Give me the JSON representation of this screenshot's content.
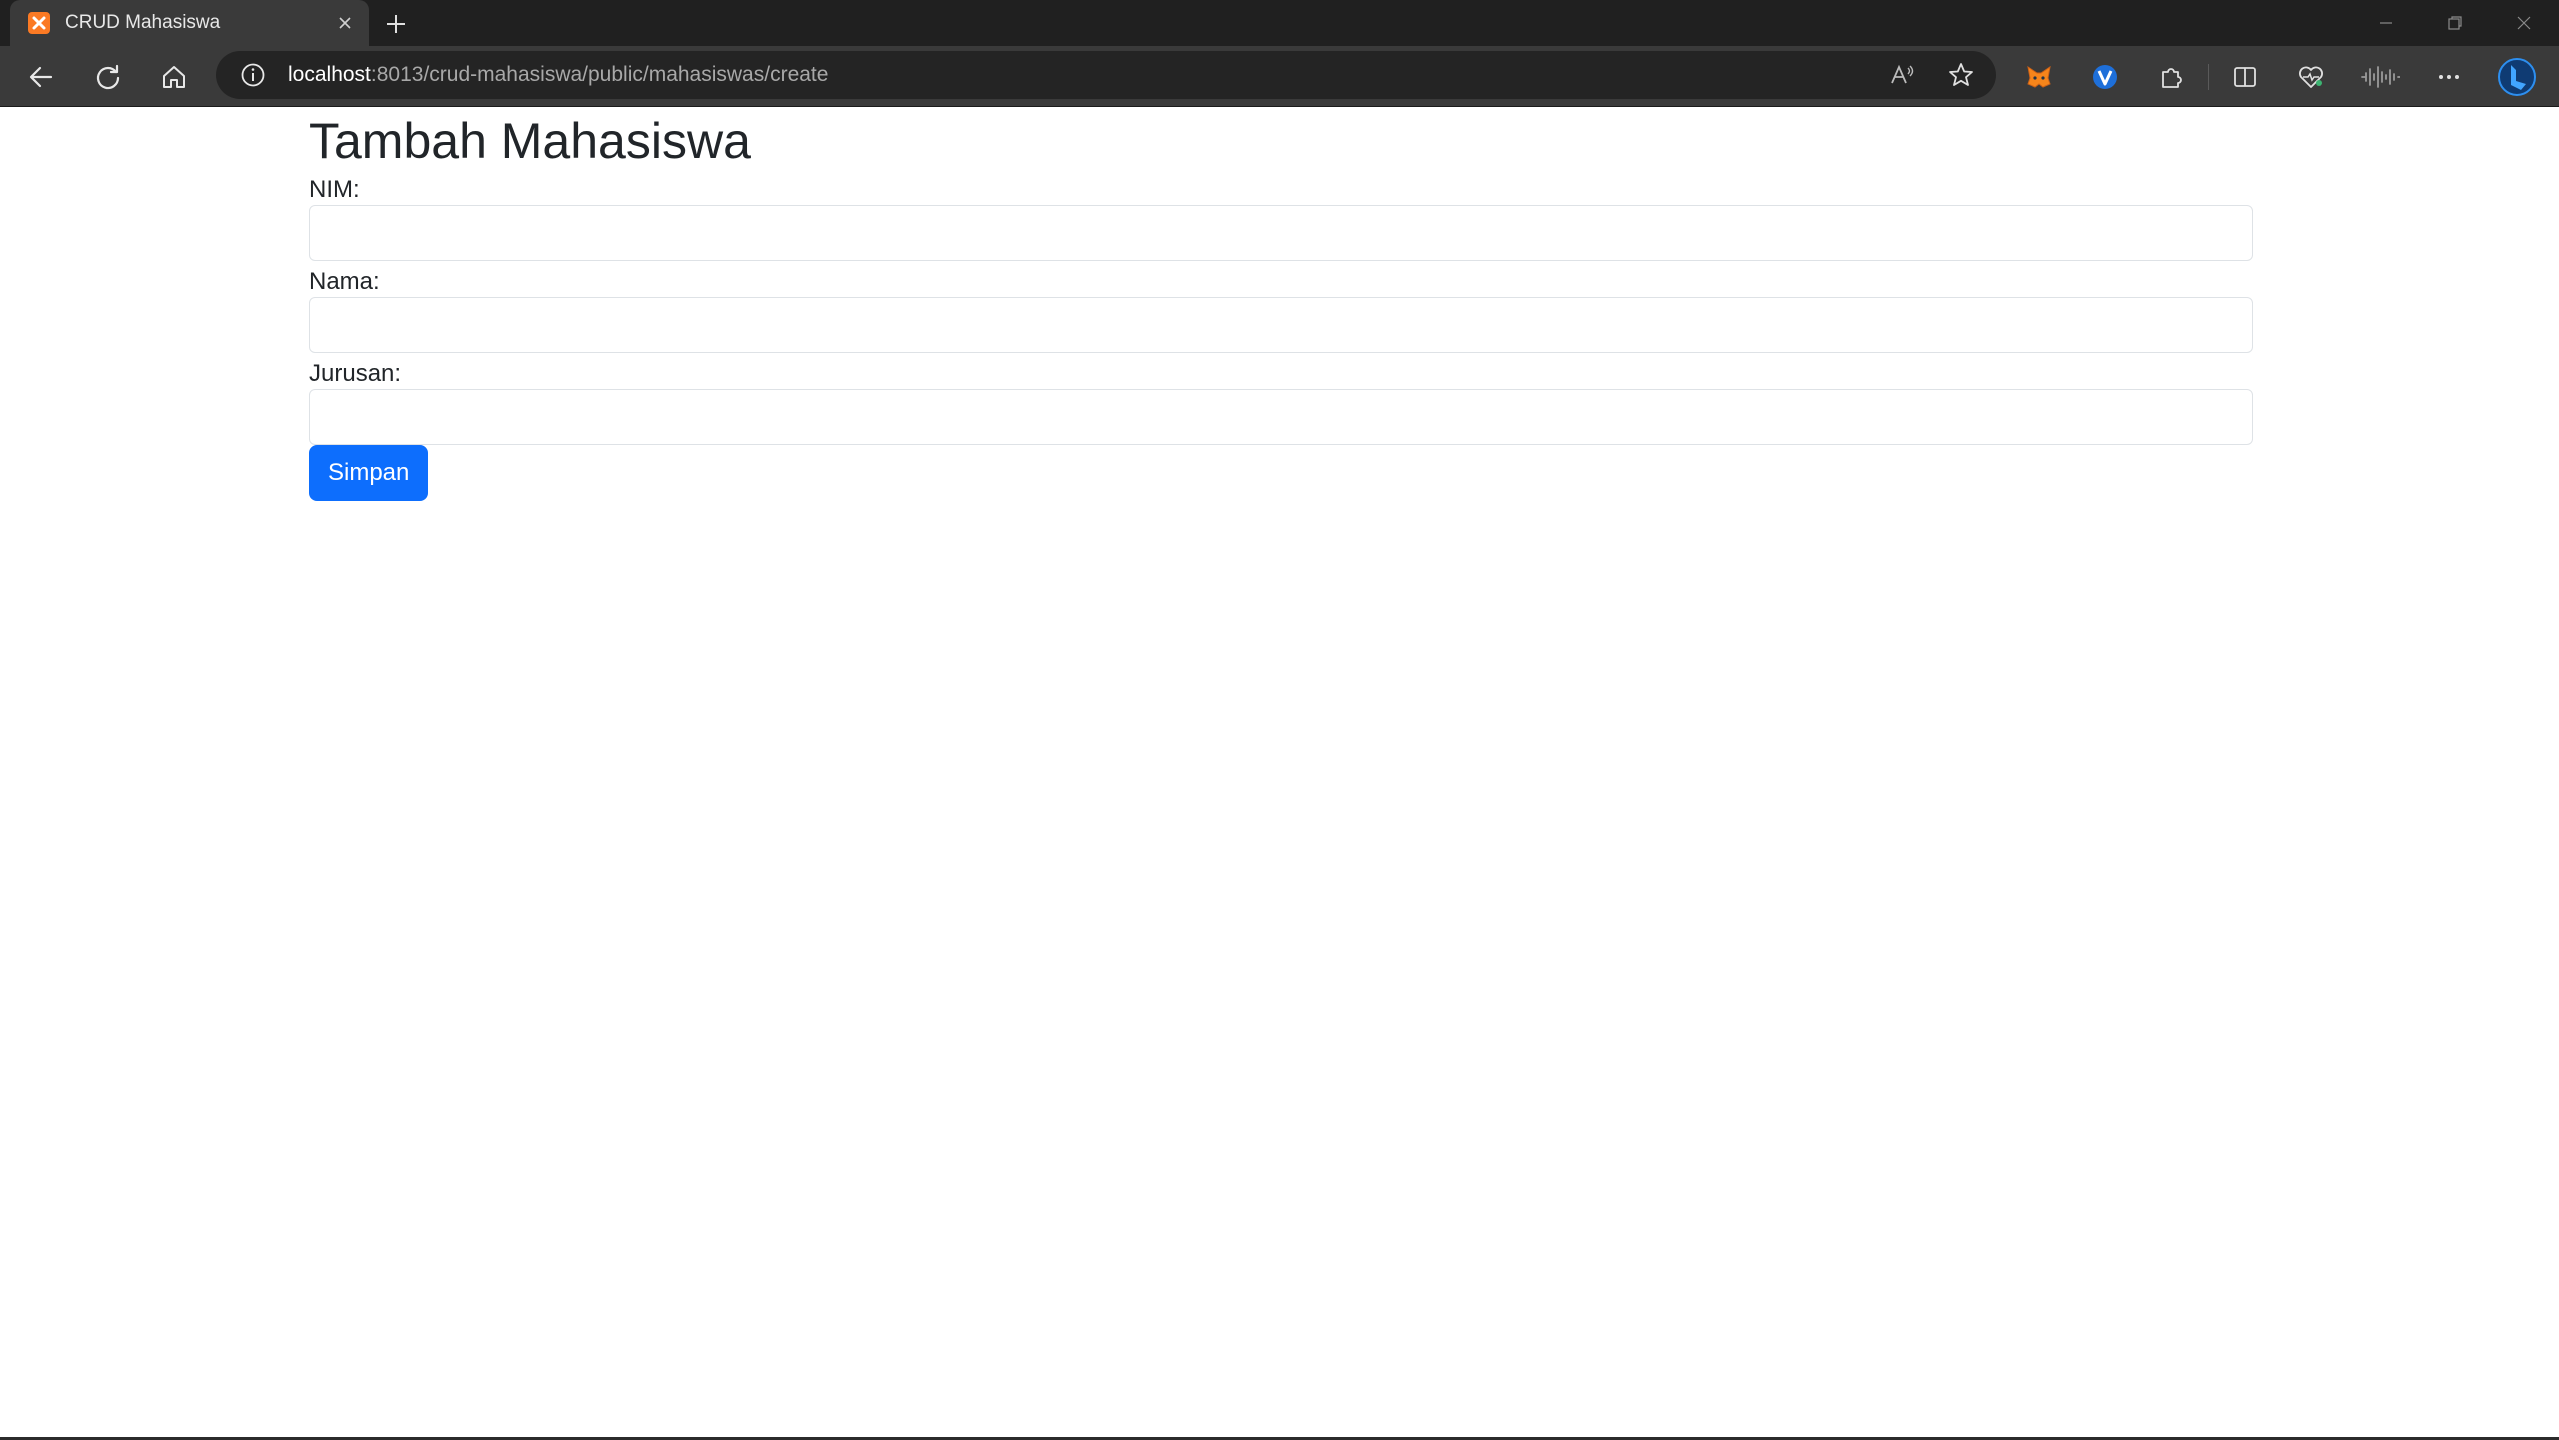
{
  "browser": {
    "tab_title": "CRUD Mahasiswa",
    "url_host": "localhost",
    "url_rest": ":8013/crud-mahasiswa/public/mahasiswas/create",
    "favicon_icon": "xampp-icon",
    "accent_color": "#0d6efd"
  },
  "page": {
    "title": "Tambah Mahasiswa",
    "fields": [
      {
        "label": "NIM:",
        "value": "",
        "placeholder": ""
      },
      {
        "label": "Nama:",
        "value": "",
        "placeholder": ""
      },
      {
        "label": "Jurusan:",
        "value": "",
        "placeholder": ""
      }
    ],
    "submit_label": "Simpan"
  }
}
